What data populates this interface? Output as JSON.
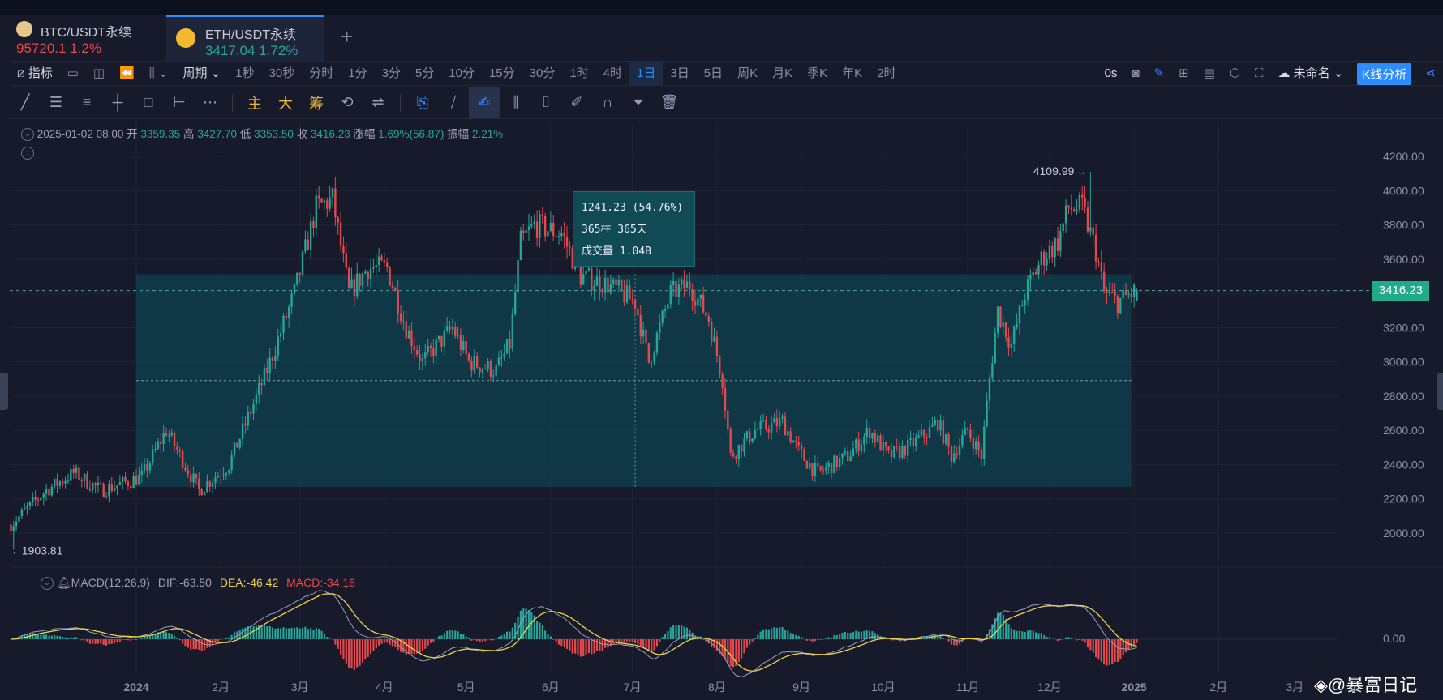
{
  "tabs": [
    {
      "name": "BTC/USDT永续",
      "price": "95720.1",
      "change": "1.2%",
      "color": "#e5484d"
    },
    {
      "name": "ETH/USDT永续",
      "price": "3417.04",
      "change": "1.72%",
      "color": "#26a69a"
    }
  ],
  "tab_add": "+",
  "toolbar": {
    "indicator": "指标",
    "period": "周期",
    "intervals": [
      "1秒",
      "30秒",
      "分时",
      "1分",
      "3分",
      "5分",
      "10分",
      "15分",
      "30分",
      "1时",
      "4时",
      "1日",
      "3日",
      "5日",
      "周K",
      "月K",
      "季K",
      "年K",
      "2时"
    ],
    "active_interval": "1日",
    "countdown": "0s",
    "layout_name": "未命名",
    "analysis_button": "K线分析"
  },
  "drawing_tools": {
    "main": "主",
    "big": "大",
    "chips": "筹"
  },
  "info": {
    "date": "2025-01-02 08:00",
    "open_label": "开",
    "open": "3359.35",
    "high_label": "高",
    "high": "3427.70",
    "low_label": "低",
    "low": "3353.50",
    "close_label": "收",
    "close": "3416.23",
    "change_label": "涨幅",
    "change": "1.69%(56.87)",
    "amp_label": "振幅",
    "amp": "2.21%"
  },
  "measure": {
    "line1": "1241.23 (54.76%)",
    "line2": "365柱 365天",
    "line3": "成交量 1.04B"
  },
  "macd": {
    "label": "MACD(12,26,9)",
    "dif": "DIF:-63.50",
    "dea": "DEA:-46.42",
    "macd": "MACD:-34.16",
    "zero_label": "0.00"
  },
  "watermark": "@暴富日记",
  "chart_data": {
    "type": "candlestick",
    "symbol": "ETH/USDT永续",
    "interval": "1日",
    "ylim": [
      1900,
      4280
    ],
    "y_ticks": [
      "4200.00",
      "4000.00",
      "3800.00",
      "3600.00",
      "3400.00",
      "3200.00",
      "3000.00",
      "2800.00",
      "2600.00",
      "2400.00",
      "2200.00",
      "2000.00"
    ],
    "x_ticks": [
      {
        "label": "2024",
        "day": 0
      },
      {
        "label": "2月",
        "day": 31
      },
      {
        "label": "3月",
        "day": 60
      },
      {
        "label": "4月",
        "day": 91
      },
      {
        "label": "5月",
        "day": 121
      },
      {
        "label": "6月",
        "day": 152
      },
      {
        "label": "7月",
        "day": 182
      },
      {
        "label": "8月",
        "day": 213
      },
      {
        "label": "9月",
        "day": 244
      },
      {
        "label": "10月",
        "day": 274
      },
      {
        "label": "11月",
        "day": 305
      },
      {
        "label": "12月",
        "day": 335
      },
      {
        "label": "2025",
        "day": 366
      },
      {
        "label": "2月",
        "day": 397
      },
      {
        "label": "3月",
        "day": 425
      }
    ],
    "price_path_day_close": [
      [
        -46,
        2050
      ],
      [
        -33,
        2250
      ],
      [
        -23,
        2350
      ],
      [
        -13,
        2250
      ],
      [
        -3,
        2300
      ],
      [
        2,
        2330
      ],
      [
        11,
        2600
      ],
      [
        23,
        2250
      ],
      [
        34,
        2400
      ],
      [
        48,
        2950
      ],
      [
        58,
        3400
      ],
      [
        66,
        3900
      ],
      [
        72,
        3950
      ],
      [
        78,
        3400
      ],
      [
        85,
        3550
      ],
      [
        92,
        3550
      ],
      [
        99,
        3200
      ],
      [
        105,
        3000
      ],
      [
        116,
        3200
      ],
      [
        122,
        3000
      ],
      [
        132,
        2950
      ],
      [
        137,
        3100
      ],
      [
        141,
        3700
      ],
      [
        146,
        3800
      ],
      [
        156,
        3750
      ],
      [
        163,
        3500
      ],
      [
        173,
        3450
      ],
      [
        183,
        3350
      ],
      [
        188,
        3000
      ],
      [
        196,
        3400
      ],
      [
        203,
        3450
      ],
      [
        210,
        3250
      ],
      [
        215,
        2900
      ],
      [
        218,
        2450
      ],
      [
        227,
        2600
      ],
      [
        237,
        2650
      ],
      [
        244,
        2450
      ],
      [
        250,
        2350
      ],
      [
        261,
        2450
      ],
      [
        269,
        2600
      ],
      [
        276,
        2450
      ],
      [
        283,
        2500
      ],
      [
        291,
        2600
      ],
      [
        294,
        2650
      ],
      [
        299,
        2450
      ],
      [
        305,
        2600
      ],
      [
        310,
        2450
      ],
      [
        313,
        2900
      ],
      [
        316,
        3300
      ],
      [
        321,
        3100
      ],
      [
        326,
        3400
      ],
      [
        332,
        3600
      ],
      [
        338,
        3700
      ],
      [
        342,
        3900
      ],
      [
        347,
        3900
      ],
      [
        352,
        3650
      ],
      [
        355,
        3400
      ],
      [
        360,
        3350
      ],
      [
        367,
        3416.23
      ]
    ],
    "last_candle": {
      "day": 367,
      "open": 3359.35,
      "high": 3427.7,
      "low": 3353.5,
      "close": 3416.23
    },
    "last_price": "3416.23",
    "period_low": {
      "label": "1903.81",
      "value": 1903.81,
      "day": -45
    },
    "period_high": {
      "label": "4109.99",
      "value": 4109.99,
      "day": 350
    },
    "measure_range": {
      "from_day": 0,
      "to_day": 365,
      "from_price": 2270,
      "to_price": 3511.23
    }
  }
}
